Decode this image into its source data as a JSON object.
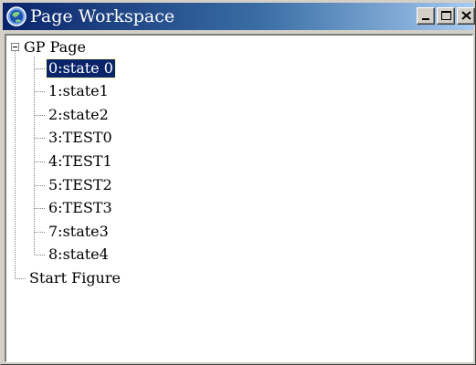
{
  "window": {
    "title": "Page Workspace"
  },
  "icons": {
    "app": "globe-icon",
    "minimize": "minimize-icon",
    "maximize": "maximize-icon",
    "close": "close-icon",
    "expander": "collapse-icon"
  },
  "tree": {
    "root": {
      "label": "GP Page",
      "expanded": true
    },
    "states": [
      {
        "label": "0:state 0",
        "selected": true
      },
      {
        "label": "1:state1"
      },
      {
        "label": "2:state2"
      },
      {
        "label": "3:TEST0"
      },
      {
        "label": "4:TEST1"
      },
      {
        "label": "5:TEST2"
      },
      {
        "label": "6:TEST3"
      },
      {
        "label": "7:state3"
      },
      {
        "label": "8:state4"
      }
    ],
    "start_figure": {
      "label": "Start Figure"
    }
  },
  "colors": {
    "titlebar_start": "#0a246a",
    "titlebar_end": "#a6caf0",
    "selection": "#0a246a"
  }
}
